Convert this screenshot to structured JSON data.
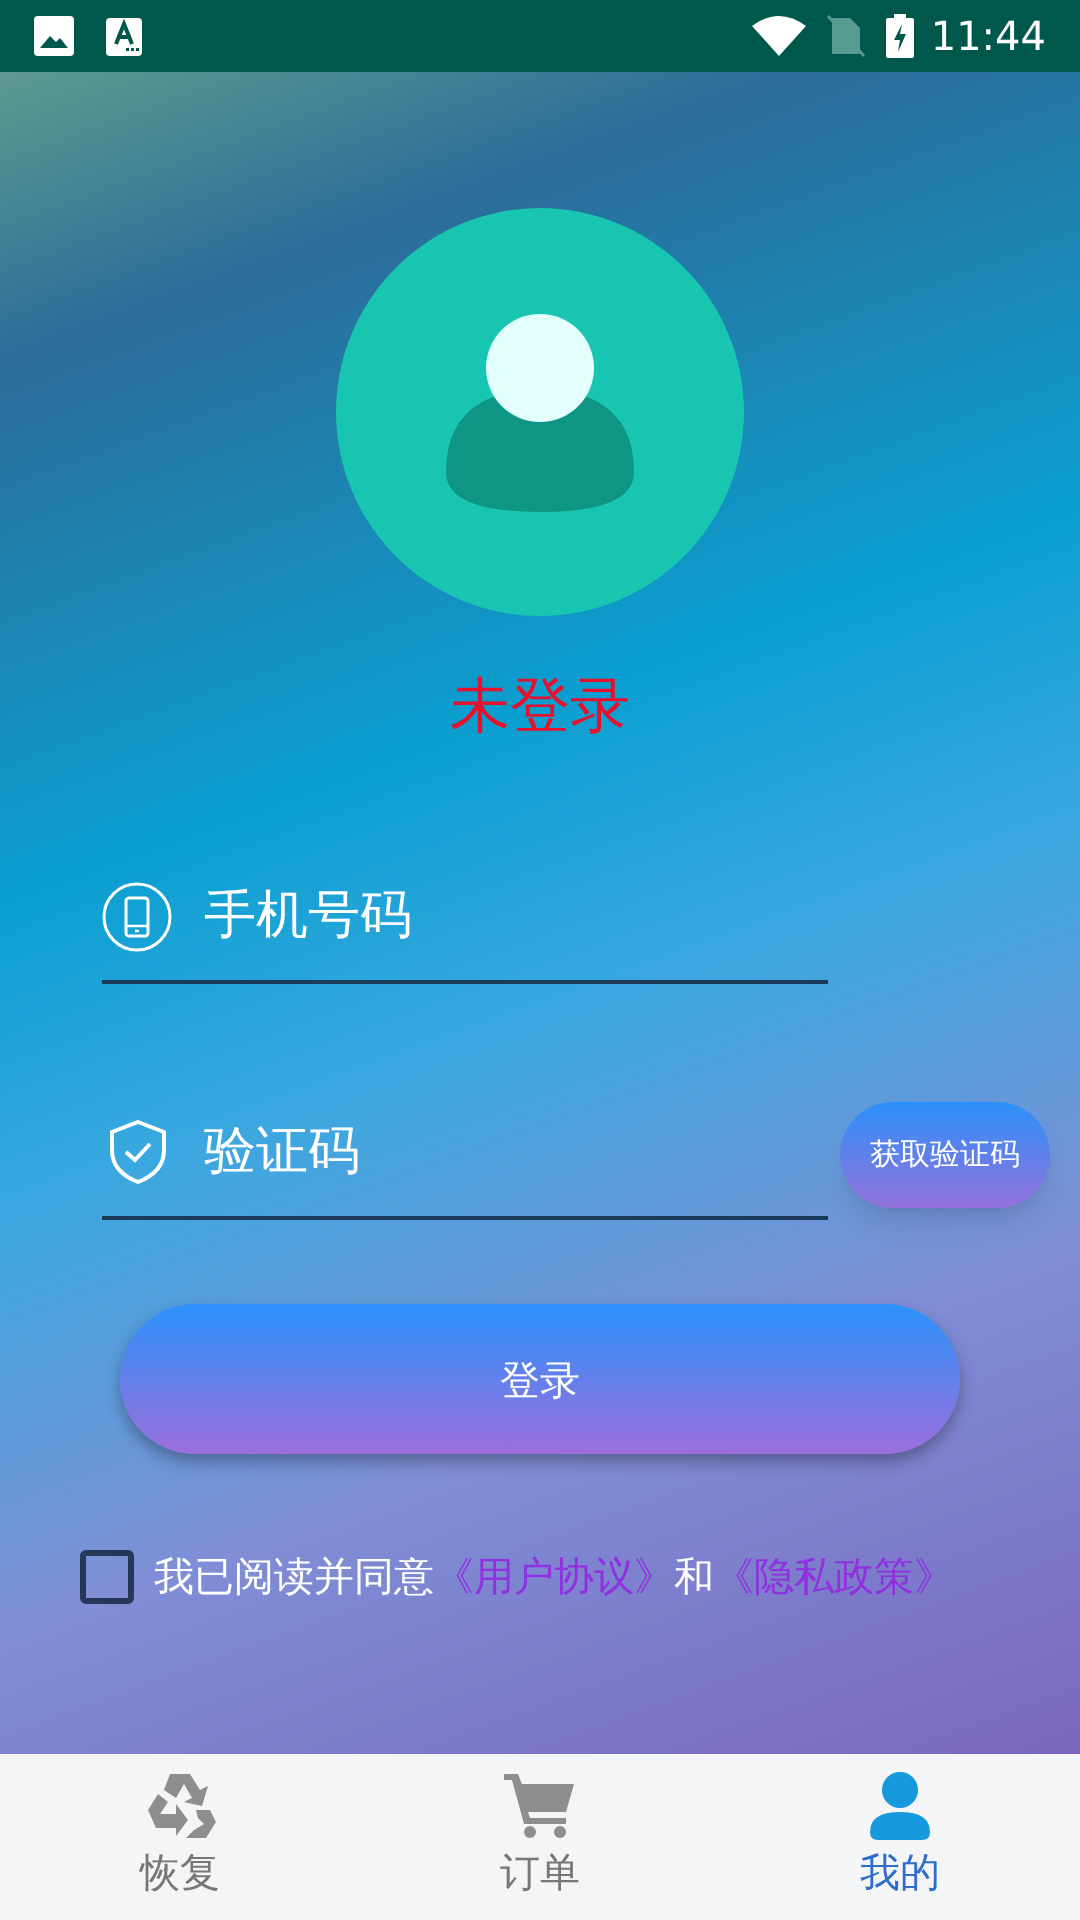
{
  "status_bar": {
    "time": "11:44"
  },
  "profile": {
    "status": "未登录"
  },
  "form": {
    "phone": {
      "placeholder": "手机号码"
    },
    "code": {
      "placeholder": "验证码"
    },
    "get_code_button": "获取验证码",
    "login_button": "登录"
  },
  "agreement": {
    "checked": false,
    "text": "我已阅读并同意",
    "user_agreement": "《用户协议》",
    "and": "和",
    "privacy_policy": "《隐私政策》"
  },
  "bottom_nav": [
    {
      "label": "恢复",
      "selected": false
    },
    {
      "label": "订单",
      "selected": false
    },
    {
      "label": "我的",
      "selected": true
    }
  ]
}
